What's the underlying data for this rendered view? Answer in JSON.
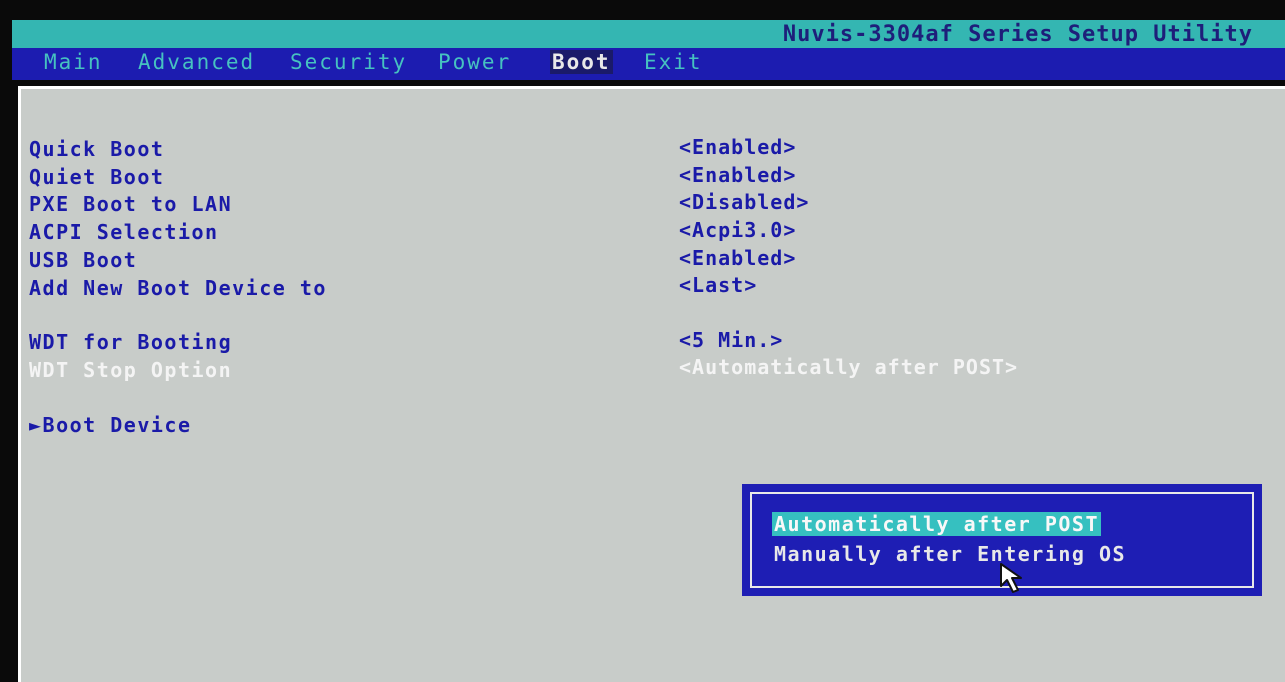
{
  "app_title": "Nuvis-3304af Series Setup Utility",
  "tabs": [
    {
      "label": "Main",
      "active": false
    },
    {
      "label": "Advanced",
      "active": false
    },
    {
      "label": "Security",
      "active": false
    },
    {
      "label": "Power",
      "active": false
    },
    {
      "label": "Boot",
      "active": true
    },
    {
      "label": "Exit",
      "active": false
    }
  ],
  "settings": [
    {
      "label": "Quick Boot",
      "value": "<Enabled>"
    },
    {
      "label": "Quiet Boot",
      "value": "<Enabled>"
    },
    {
      "label": "PXE Boot to LAN",
      "value": "<Disabled>"
    },
    {
      "label": "ACPI Selection",
      "value": "<Acpi3.0>"
    },
    {
      "label": "USB Boot",
      "value": "<Enabled>"
    },
    {
      "label": "Add New Boot Device to",
      "value": "<Last>"
    },
    {
      "label": "WDT for Booting",
      "value": "<5 Min.>"
    },
    {
      "label": "WDT Stop Option",
      "value": "<Automatically after POST>",
      "selected": true
    }
  ],
  "submenu": {
    "label": "►Boot Device"
  },
  "popup": {
    "options": [
      {
        "label": "Automatically after POST",
        "highlighted": true
      },
      {
        "label": "Manually after Entering OS",
        "highlighted": false
      }
    ]
  },
  "colors": {
    "title_bar": "#34b6b2",
    "menu_bar": "#1c1cb0",
    "panel_bg": "#c8ccc9",
    "text_blue": "#1a1aa8",
    "highlight": "#36c0c0"
  },
  "icons": {
    "cursor": "mouse-pointer-icon",
    "submenu_marker": "triangle-right-icon"
  }
}
